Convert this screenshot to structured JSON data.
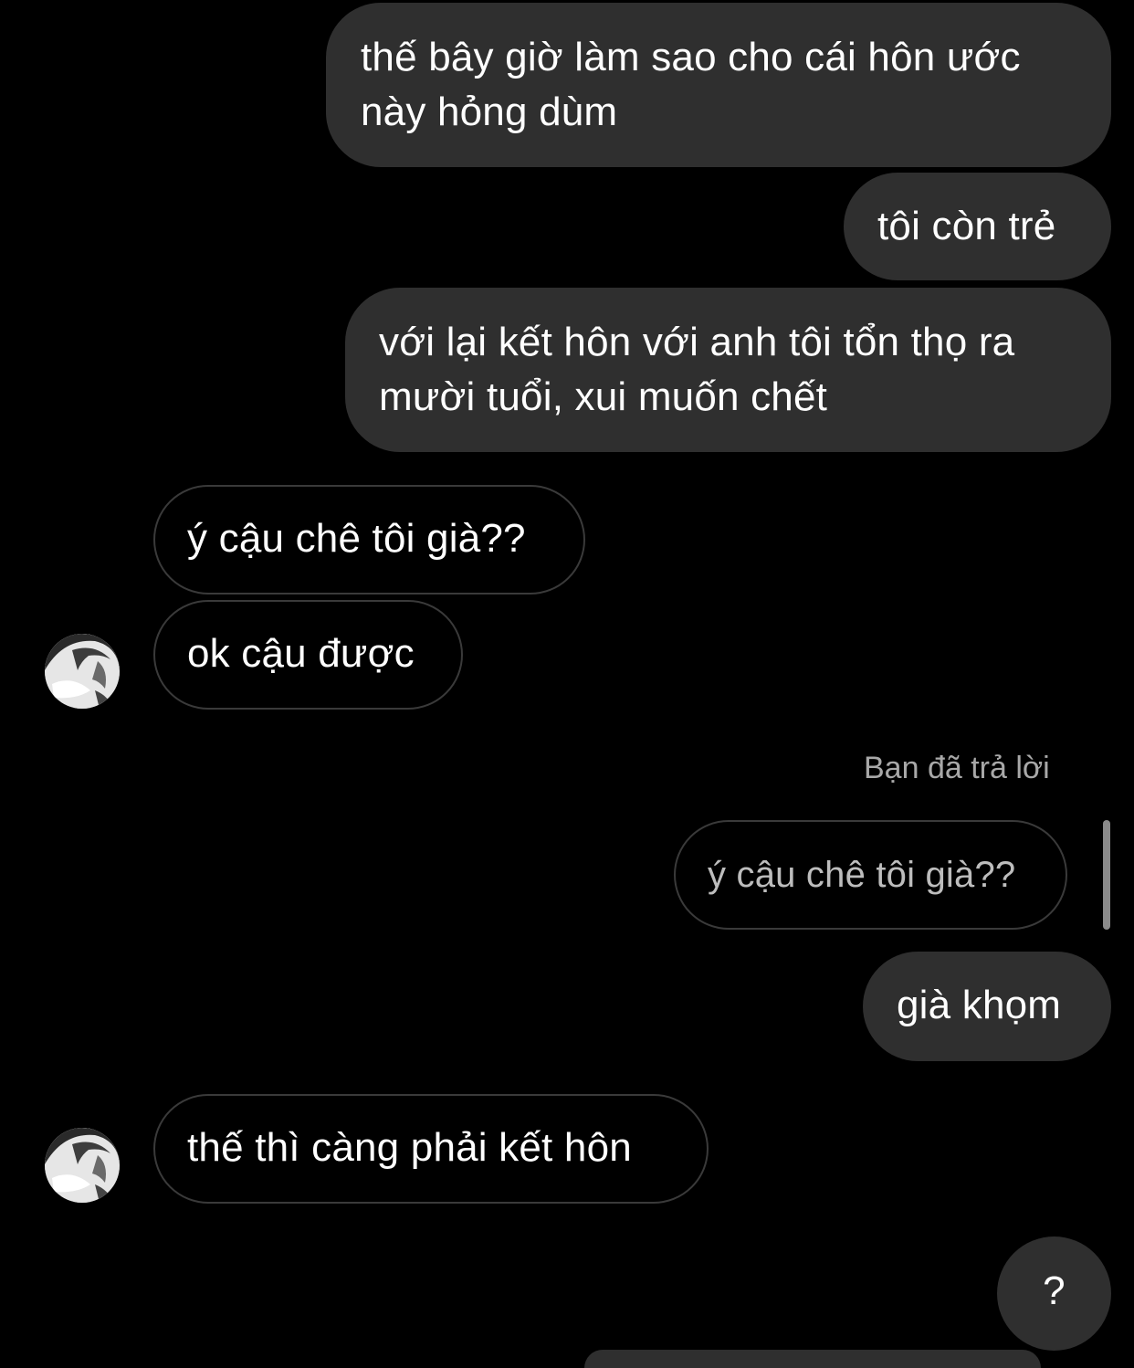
{
  "messages": [
    {
      "from": "me",
      "line1": "thế bây giờ làm sao cho cái hôn ước",
      "line2": "này hỏng dùm"
    },
    {
      "from": "me",
      "text": "tôi còn trẻ"
    },
    {
      "from": "me",
      "line1": "với lại kết hôn với anh tôi tổn thọ ra",
      "line2": "mười tuổi, xui muốn chết"
    },
    {
      "from": "them",
      "text": "ý cậu chê tôi già??"
    },
    {
      "from": "them",
      "text": "ok cậu được"
    },
    {
      "from": "me",
      "text": "già khọm"
    },
    {
      "from": "them",
      "text": "thế thì càng phải kết hôn"
    },
    {
      "from": "me",
      "text": "?"
    }
  ],
  "reply": {
    "label": "Bạn đã trả lời",
    "quoted": "ý cậu chê tôi già??"
  },
  "colors": {
    "background": "#000000",
    "sent_bubble": "#2f2f2f",
    "received_border": "#3a3a3a",
    "text": "#ffffff"
  }
}
